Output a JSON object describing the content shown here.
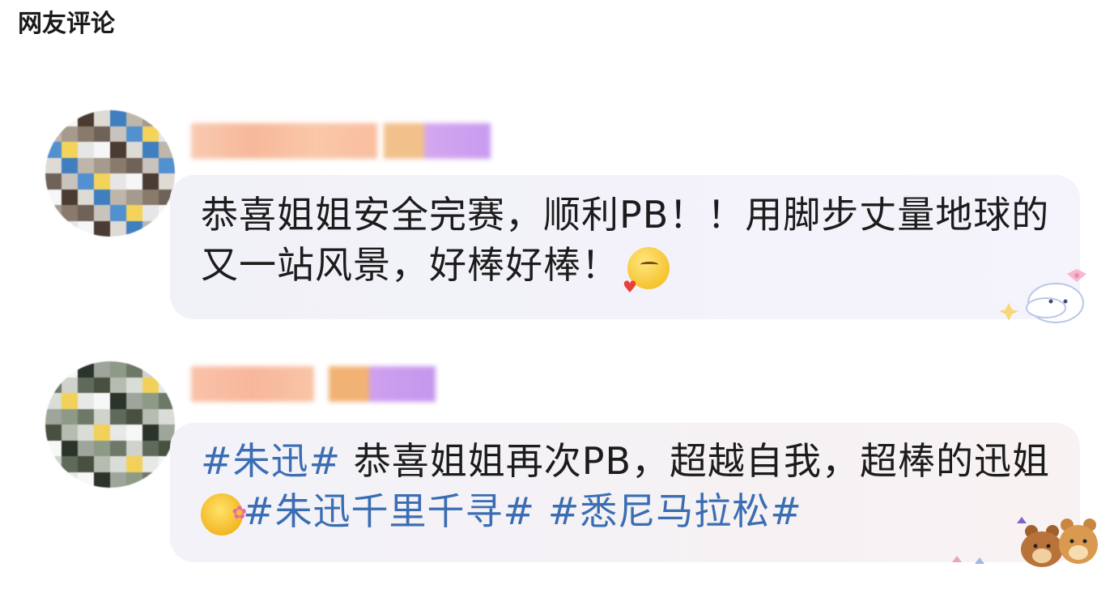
{
  "section": {
    "title": "网友评论"
  },
  "comments": [
    {
      "text": "恭喜姐姐安全完赛，顺利PB！！用脚步丈量地球的又一站风景，好棒好棒！",
      "emoji": "kiss-face-icon",
      "sticker": "bunny-sticker"
    },
    {
      "parts": {
        "tag1": "#朱迅#",
        "body": " 恭喜姐姐再次PB，超越自我，超棒的迅姐",
        "tag2": "#朱迅千里千寻#",
        "space": " ",
        "tag3": "#悉尼马拉松#"
      },
      "emoji": "flower-face-icon",
      "sticker": "bears-sticker"
    }
  ],
  "colors": {
    "hashtag": "#3b6db3",
    "text": "#1c1c1c",
    "bubble": "#f2f1f8"
  }
}
